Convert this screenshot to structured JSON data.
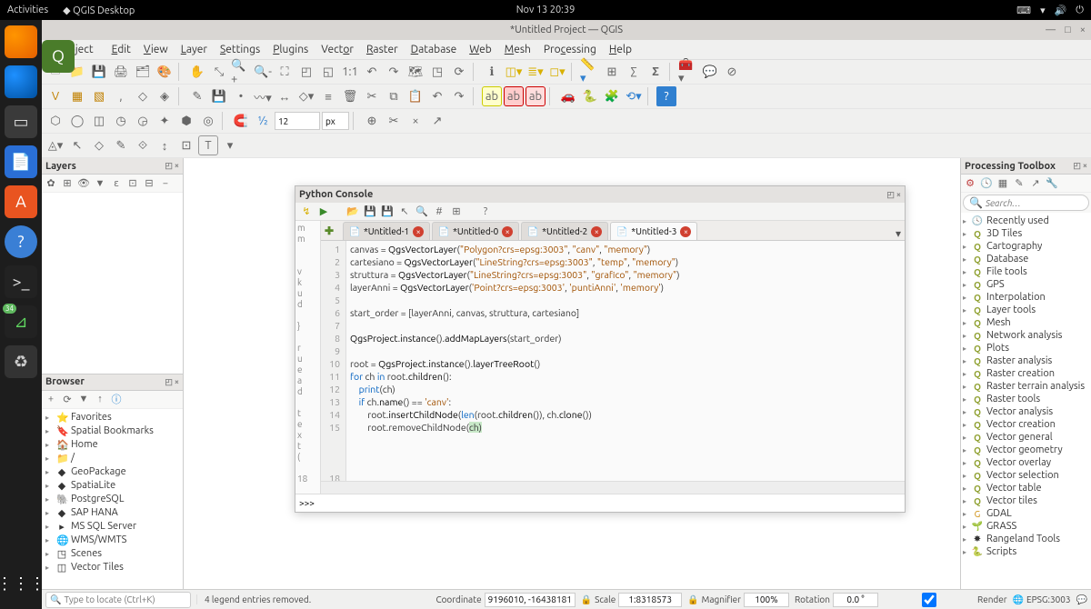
{
  "gnome": {
    "activities": "Activities",
    "app_name": "QGIS Desktop",
    "clock": "Nov 13  20:39"
  },
  "dock": {
    "badge_count": "34"
  },
  "window": {
    "title": "*Untitled Project — QGIS"
  },
  "menu": {
    "project": "Project",
    "edit": "Edit",
    "view": "View",
    "layer": "Layer",
    "settings": "Settings",
    "plugins": "Plugins",
    "vector": "Vector",
    "raster": "Raster",
    "database": "Database",
    "web": "Web",
    "mesh": "Mesh",
    "processing": "Processing",
    "help": "Help"
  },
  "toolbar_inputs": {
    "size": "12",
    "unit": "px"
  },
  "layers_panel": {
    "title": "Layers"
  },
  "browser_panel": {
    "title": "Browser",
    "items": [
      "Favorites",
      "Spatial Bookmarks",
      "Home",
      "/",
      "GeoPackage",
      "SpatiaLite",
      "PostgreSQL",
      "SAP HANA",
      "MS SQL Server",
      "WMS/WMTS",
      "Scenes",
      "Vector Tiles"
    ]
  },
  "processing_panel": {
    "title": "Processing Toolbox",
    "search_placeholder": "Search…",
    "items": [
      "Recently used",
      "3D Tiles",
      "Cartography",
      "Database",
      "File tools",
      "GPS",
      "Interpolation",
      "Layer tools",
      "Mesh",
      "Network analysis",
      "Plots",
      "Raster analysis",
      "Raster creation",
      "Raster terrain analysis",
      "Raster tools",
      "Vector analysis",
      "Vector creation",
      "Vector general",
      "Vector geometry",
      "Vector overlay",
      "Vector selection",
      "Vector table",
      "Vector tiles",
      "GDAL",
      "GRASS",
      "Rangeland Tools",
      "Scripts"
    ]
  },
  "python": {
    "title": "Python Console",
    "tabs": [
      "*Untitled-1",
      "*Untitled-0",
      "*Untitled-2",
      "*Untitled-3"
    ],
    "active_tab": 3,
    "output_markers": [
      "m",
      "m",
      "",
      "",
      "v",
      "k",
      "u",
      "d",
      "",
      "}",
      "",
      "r",
      "u",
      "e",
      "a",
      "d",
      "",
      "t",
      "e",
      "x",
      "t",
      "(",
      "",
      "18",
      ""
    ],
    "code_lines": [
      "canvas = QgsVectorLayer(\"Polygon?crs=epsg:3003\", \"canv\", \"memory\")",
      "cartesiano = QgsVectorLayer(\"LineString?crs=epsg:3003\", \"temp\", \"memory\")",
      "struttura = QgsVectorLayer(\"LineString?crs=epsg:3003\", \"grafico\", \"memory\")",
      "layerAnni = QgsVectorLayer('Point?crs=epsg:3003', 'puntiAnni', 'memory')",
      "",
      "start_order = [layerAnni, canvas, struttura, cartesiano]",
      "",
      "QgsProject.instance().addMapLayers(start_order)",
      "",
      "root = QgsProject.instance().layerTreeRoot()",
      "for ch in root.children():",
      "    print(ch)",
      "    if ch.name() == 'canv':",
      "        root.insertChildNode(len(root.children()), ch.clone())",
      "        root.removeChildNode(ch)"
    ],
    "prompt": ">>>",
    "last_gutter": "18"
  },
  "status": {
    "locator_placeholder": "Type to locate (Ctrl+K)",
    "message": "4 legend entries removed.",
    "coord_label": "Coordinate",
    "coord_value": "9196010, -16438181",
    "scale_label": "Scale",
    "scale_value": "1:8318573",
    "magnifier_label": "Magnifier",
    "magnifier_value": "100%",
    "rotation_label": "Rotation",
    "rotation_value": "0.0 °",
    "render_label": "Render",
    "crs": "EPSG:3003"
  }
}
